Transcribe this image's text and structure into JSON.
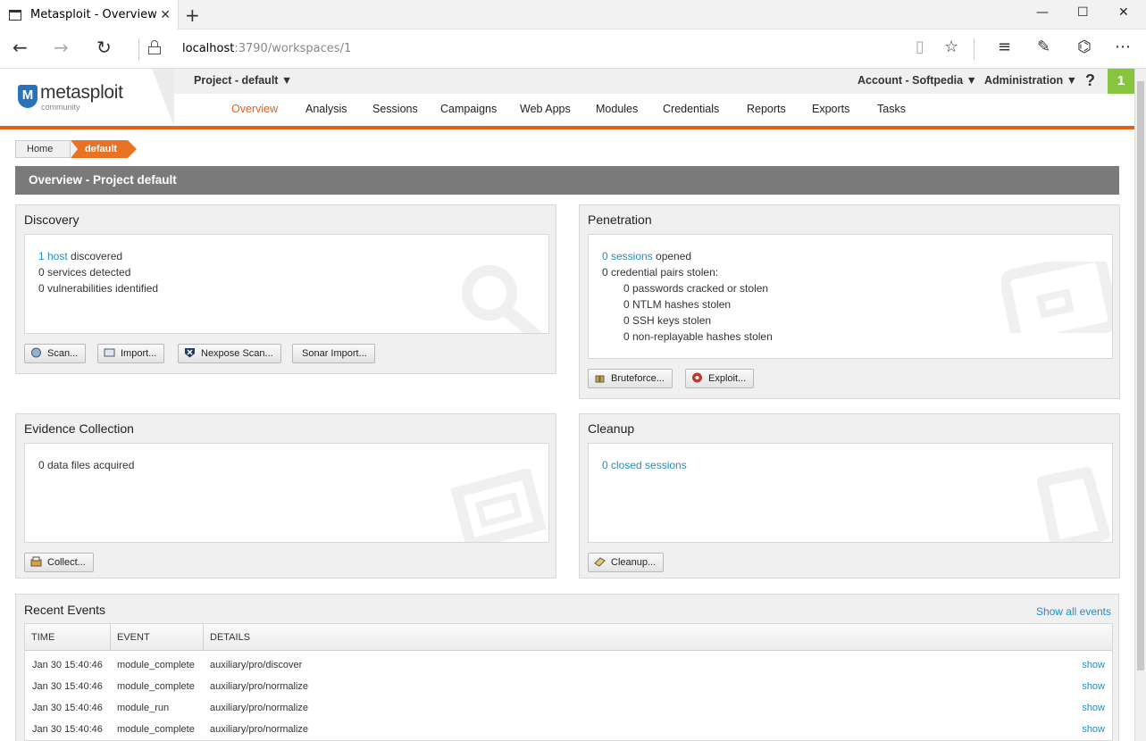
{
  "browser": {
    "tab_title": "Metasploit - Overview",
    "tab_close": "✕",
    "new_tab": "+",
    "url_host": "localhost",
    "url_path": ":3790/workspaces/1",
    "window_controls": {
      "minimize": "—",
      "maximize": "☐",
      "close": "✕"
    }
  },
  "app": {
    "logo_text": "metasploit",
    "logo_sub": "community",
    "logo_mark": "M",
    "project_dropdown": "Project - default ▼",
    "account_dropdown": "Account - Softpedia ▼",
    "admin_dropdown": "Administration ▼",
    "help": "?",
    "notification_count": "1",
    "nav": [
      "Overview",
      "Analysis",
      "Sessions",
      "Campaigns",
      "Web Apps",
      "Modules",
      "Credentials",
      "Reports",
      "Exports",
      "Tasks"
    ],
    "active_nav": "Overview",
    "accent_color": "#e5601c",
    "link_color": "#1b8fc8"
  },
  "breadcrumb": {
    "home": "Home",
    "current": "default"
  },
  "banner": "Overview - Project default",
  "discovery": {
    "title": "Discovery",
    "host_link": "1 host",
    "host_text": " discovered",
    "services": "0 services detected",
    "vulns": "0 vulnerabilities identified",
    "buttons": [
      "Scan...",
      "Import...",
      "Nexpose Scan...",
      "Sonar Import..."
    ]
  },
  "penetration": {
    "title": "Penetration",
    "sessions_link": "0 sessions",
    "sessions_text": " opened",
    "cred_pairs": "0 credential pairs stolen:",
    "passwords": "0 passwords cracked or stolen",
    "ntlm": "0 NTLM hashes stolen",
    "ssh": "0 SSH keys stolen",
    "nonreplay": "0 non-replayable hashes stolen",
    "buttons": [
      "Bruteforce...",
      "Exploit..."
    ]
  },
  "evidence": {
    "title": "Evidence Collection",
    "files": "0 data files acquired",
    "buttons": [
      "Collect..."
    ]
  },
  "cleanup": {
    "title": "Cleanup",
    "closed_link": "0 closed sessions",
    "buttons": [
      "Cleanup..."
    ]
  },
  "events": {
    "title": "Recent Events",
    "show_all": "Show all events",
    "headers": [
      "TIME",
      "EVENT",
      "DETAILS"
    ],
    "show_label": "show",
    "rows": [
      {
        "time": "Jan 30 15:40:46",
        "event": "module_complete",
        "details": "auxiliary/pro/discover"
      },
      {
        "time": "Jan 30 15:40:46",
        "event": "module_complete",
        "details": "auxiliary/pro/normalize"
      },
      {
        "time": "Jan 30 15:40:46",
        "event": "module_run",
        "details": "auxiliary/pro/normalize"
      },
      {
        "time": "Jan 30 15:40:46",
        "event": "module_complete",
        "details": "auxiliary/pro/normalize"
      }
    ]
  }
}
